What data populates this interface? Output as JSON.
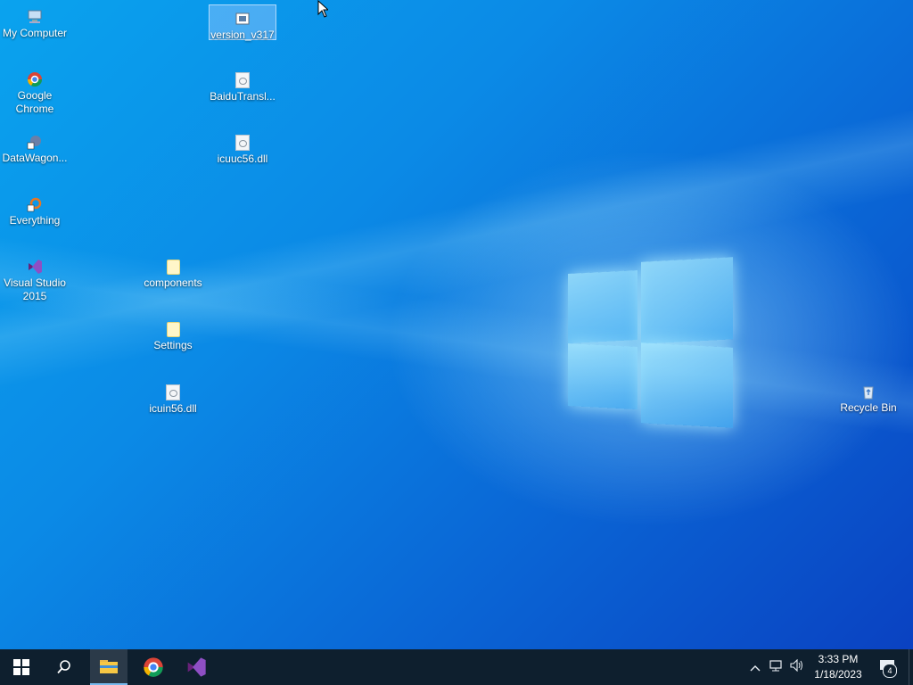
{
  "desktop": {
    "icons": [
      {
        "label": "My Computer"
      },
      {
        "label": "Google Chrome"
      },
      {
        "label": "DataWagon..."
      },
      {
        "label": "Everything"
      },
      {
        "label": "Visual Studio 2015"
      },
      {
        "label": "version_v317"
      },
      {
        "label": "BaiduTransl..."
      },
      {
        "label": "icuuc56.dll"
      },
      {
        "label": "components"
      },
      {
        "label": "Settings"
      },
      {
        "label": "icuin56.dll"
      },
      {
        "label": "Recycle Bin"
      }
    ]
  },
  "taskbar": {
    "pinned": [
      "start-icon",
      "search-icon",
      "file-explorer-icon",
      "chrome-icon",
      "visual-studio-icon"
    ],
    "tray": [
      "chevron-up-icon",
      "network-icon",
      "volume-icon"
    ],
    "time": "3:33 PM",
    "date": "1/18/2023",
    "notification_count": "4"
  },
  "colors": {
    "taskbar_bg": "#0e1f2e",
    "desktop_accent": "#0a8ae6"
  }
}
